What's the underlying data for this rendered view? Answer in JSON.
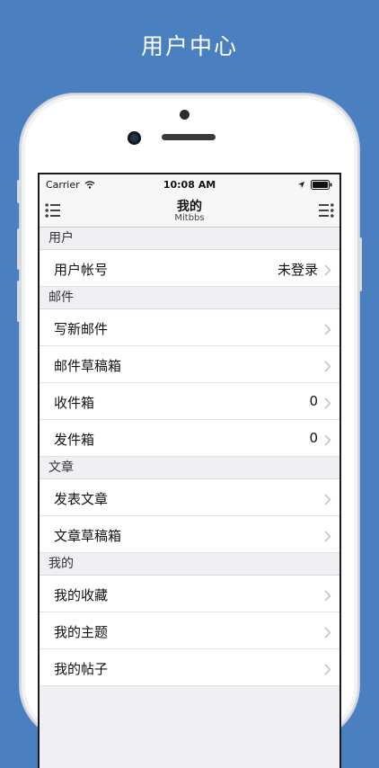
{
  "promo": {
    "title": "用户中心"
  },
  "status": {
    "carrier": "Carrier",
    "time": "10:08 AM"
  },
  "nav": {
    "title": "我的",
    "subtitle": "Mitbbs"
  },
  "icons": {
    "left": "list-menu-icon",
    "right": "list-menu-icon",
    "chevron": "chevron-right-icon",
    "wifi": "wifi-icon",
    "location": "location-arrow-icon",
    "battery": "battery-icon"
  },
  "colors": {
    "background": "#4a80c0",
    "chevron": "#c7c7cc"
  },
  "sections": [
    {
      "header": "用户",
      "rows": [
        {
          "label": "用户帐号",
          "value": "未登录"
        }
      ]
    },
    {
      "header": "邮件",
      "rows": [
        {
          "label": "写新邮件",
          "value": ""
        },
        {
          "label": "邮件草稿箱",
          "value": ""
        },
        {
          "label": "收件箱",
          "value": "0"
        },
        {
          "label": "发件箱",
          "value": "0"
        }
      ]
    },
    {
      "header": "文章",
      "rows": [
        {
          "label": "发表文章",
          "value": ""
        },
        {
          "label": "文章草稿箱",
          "value": ""
        }
      ]
    },
    {
      "header": "我的",
      "rows": [
        {
          "label": "我的收藏",
          "value": ""
        },
        {
          "label": "我的主题",
          "value": ""
        },
        {
          "label": "我的帖子",
          "value": ""
        }
      ]
    }
  ]
}
